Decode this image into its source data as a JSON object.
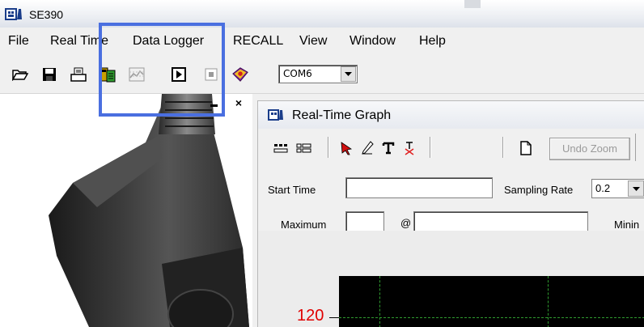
{
  "app": {
    "title": "SE390"
  },
  "menu": [
    "File",
    "Real Time",
    "Data Logger",
    "RECALL",
    "View",
    "Window",
    "Help"
  ],
  "toolbar": {
    "icons": [
      "open-folder-icon",
      "save-disk-icon",
      "print-icon",
      "data-transfer-icon",
      "chart-icon",
      "play-icon",
      "stop-icon",
      "help-book-icon"
    ],
    "com_port": "COM6"
  },
  "left_pane": {
    "close_glyph": "×"
  },
  "graph_window": {
    "title": "Real-Time Graph",
    "undo_zoom_label": "Undo Zoom",
    "start_time_label": "Start Time",
    "start_time_value": "",
    "sampling_rate_label": "Sampling Rate",
    "sampling_rate_value": "0.2",
    "maximum_label": "Maximum",
    "maximum_value": "",
    "at_label": "@",
    "at_value": "",
    "minimum_label_partial": "Minin",
    "y_tick": "120"
  },
  "colors": {
    "highlight": "#4a6fe0",
    "grid": "#2f9b2f",
    "tick_label": "#e00000"
  }
}
